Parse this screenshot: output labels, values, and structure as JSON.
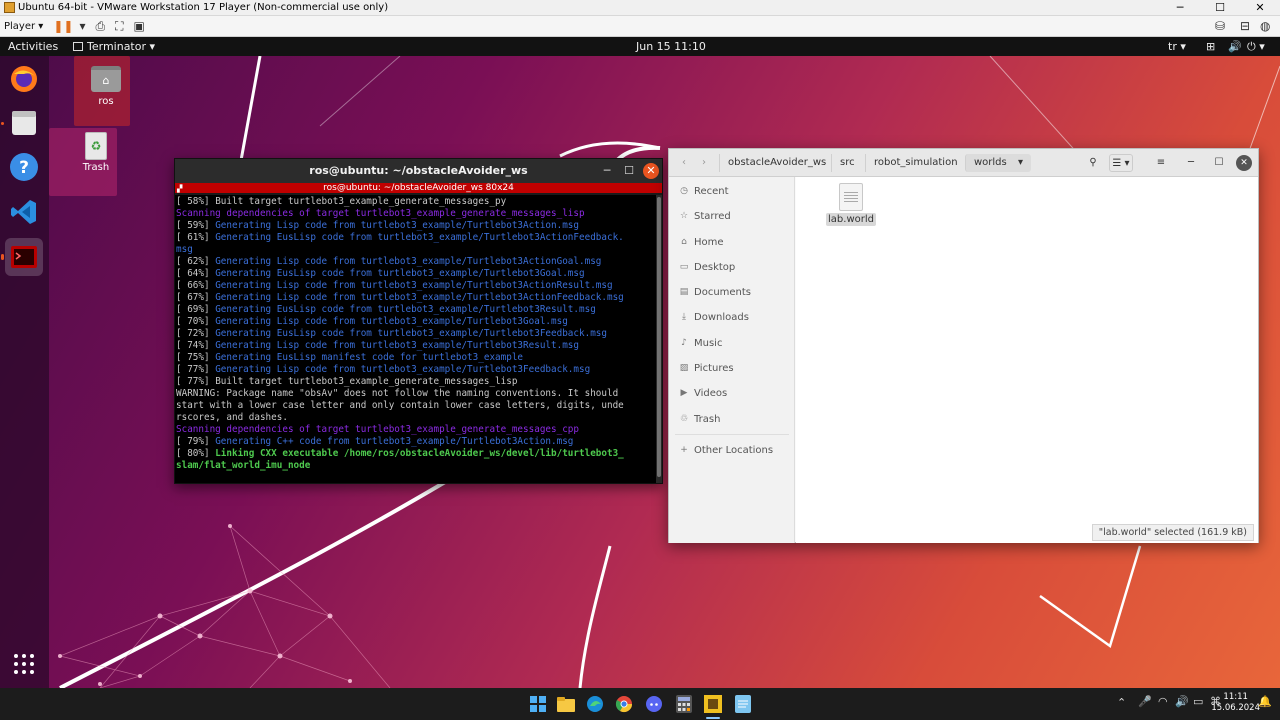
{
  "vmware": {
    "title": "Ubuntu 64-bit - VMware Workstation 17 Player (Non-commercial use only)",
    "player_label": "Player",
    "controls": [
      "─",
      "☐",
      "✕"
    ]
  },
  "topbar": {
    "activities": "Activities",
    "app_menu": "Terminator",
    "clock": "Jun 15  11:10",
    "keyboard": "tr"
  },
  "desktop_icons": [
    {
      "label": "ros"
    },
    {
      "label": "Trash"
    }
  ],
  "terminal": {
    "title": "ros@ubuntu: ~/obstacleAvoider_ws",
    "subtitle": "ros@ubuntu: ~/obstacleAvoider_ws 80x24",
    "lines": [
      {
        "pct": "[ 58%] ",
        "text": "Built target turtlebot3_example_generate_messages_py",
        "style": "c-norm"
      },
      {
        "pct": "",
        "text": "Scanning dependencies of target turtlebot3_example_generate_messages_lisp",
        "style": "c-scan"
      },
      {
        "pct": "[ 59%] ",
        "text": "Generating Lisp code from turtlebot3_example/Turtlebot3Action.msg",
        "style": "c-gen"
      },
      {
        "pct": "[ 61%] ",
        "text": "Generating EusLisp code from turtlebot3_example/Turtlebot3ActionFeedback.",
        "style": "c-gen"
      },
      {
        "pct": "",
        "text": "msg",
        "style": "c-gen"
      },
      {
        "pct": "[ 62%] ",
        "text": "Generating Lisp code from turtlebot3_example/Turtlebot3ActionGoal.msg",
        "style": "c-gen"
      },
      {
        "pct": "[ 64%] ",
        "text": "Generating EusLisp code from turtlebot3_example/Turtlebot3Goal.msg",
        "style": "c-gen"
      },
      {
        "pct": "[ 66%] ",
        "text": "Generating Lisp code from turtlebot3_example/Turtlebot3ActionResult.msg",
        "style": "c-gen"
      },
      {
        "pct": "[ 67%] ",
        "text": "Generating Lisp code from turtlebot3_example/Turtlebot3ActionFeedback.msg",
        "style": "c-gen"
      },
      {
        "pct": "[ 69%] ",
        "text": "Generating EusLisp code from turtlebot3_example/Turtlebot3Result.msg",
        "style": "c-gen"
      },
      {
        "pct": "[ 70%] ",
        "text": "Generating Lisp code from turtlebot3_example/Turtlebot3Goal.msg",
        "style": "c-gen"
      },
      {
        "pct": "[ 72%] ",
        "text": "Generating EusLisp code from turtlebot3_example/Turtlebot3Feedback.msg",
        "style": "c-gen"
      },
      {
        "pct": "[ 74%] ",
        "text": "Generating Lisp code from turtlebot3_example/Turtlebot3Result.msg",
        "style": "c-gen"
      },
      {
        "pct": "[ 75%] ",
        "text": "Generating EusLisp manifest code for turtlebot3_example",
        "style": "c-gen"
      },
      {
        "pct": "[ 77%] ",
        "text": "Generating Lisp code from turtlebot3_example/Turtlebot3Feedback.msg",
        "style": "c-gen"
      },
      {
        "pct": "[ 77%] ",
        "text": "Built target turtlebot3_example_generate_messages_lisp",
        "style": "c-norm"
      },
      {
        "pct": "",
        "text": "WARNING: Package name \"obsAv\" does not follow the naming conventions. It should",
        "style": "c-norm"
      },
      {
        "pct": "",
        "text": "start with a lower case letter and only contain lower case letters, digits, unde",
        "style": "c-norm"
      },
      {
        "pct": "",
        "text": "rscores, and dashes.",
        "style": "c-norm"
      },
      {
        "pct": "",
        "text": "Scanning dependencies of target turtlebot3_example_generate_messages_cpp",
        "style": "c-scan"
      },
      {
        "pct": "[ 79%] ",
        "text": "Generating C++ code from turtlebot3_example/Turtlebot3Action.msg",
        "style": "c-gen"
      },
      {
        "pct": "[ 80%] ",
        "text": "Linking CXX executable /home/ros/obstacleAvoider_ws/devel/lib/turtlebot3_",
        "style": "c-link"
      },
      {
        "pct": "",
        "text": "slam/flat_world_imu_node",
        "style": "c-link"
      }
    ]
  },
  "files": {
    "breadcrumbs": [
      "obstacleAvoider_ws",
      "src",
      "robot_simulation",
      "worlds"
    ],
    "sidebar": [
      {
        "label": "Recent",
        "icon": "clock-icon"
      },
      {
        "label": "Starred",
        "icon": "star-icon"
      },
      {
        "label": "Home",
        "icon": "home-icon"
      },
      {
        "label": "Desktop",
        "icon": "desktop-icon"
      },
      {
        "label": "Documents",
        "icon": "documents-icon"
      },
      {
        "label": "Downloads",
        "icon": "downloads-icon"
      },
      {
        "label": "Music",
        "icon": "music-icon"
      },
      {
        "label": "Pictures",
        "icon": "pictures-icon"
      },
      {
        "label": "Videos",
        "icon": "videos-icon"
      },
      {
        "label": "Trash",
        "icon": "trash-icon"
      },
      {
        "label": "Other Locations",
        "icon": "plus-icon"
      }
    ],
    "file_name": "lab.world",
    "status": "\"lab.world\" selected  (161.9 kB)"
  },
  "taskbar": {
    "time": "11:11",
    "date": "15.06.2024"
  },
  "colors": {
    "ubuntu_orange": "#e95420",
    "terminal_red": "#c00000"
  }
}
